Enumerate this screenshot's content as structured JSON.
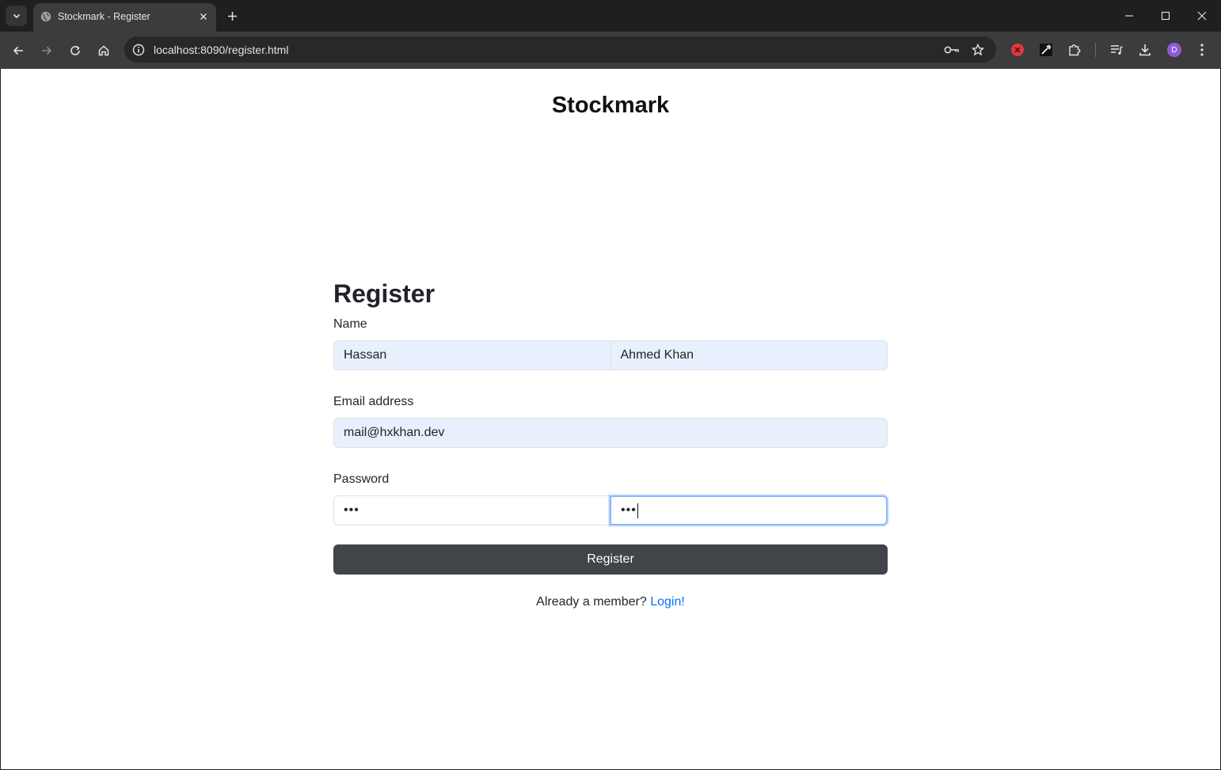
{
  "browser": {
    "tab_title": "Stockmark - Register",
    "url": "localhost:8090/register.html",
    "profile_initial": "D"
  },
  "page": {
    "brand": "Stockmark",
    "form_title": "Register",
    "name_label": "Name",
    "first_name_value": "Hassan",
    "last_name_value": "Ahmed Khan",
    "email_label": "Email address",
    "email_value": "mail@hxkhan.dev",
    "password_label": "Password",
    "password_value_masked": "•••",
    "confirm_password_value_masked": "•••",
    "register_button": "Register",
    "member_text": "Already a member?",
    "login_link": "Login!"
  },
  "icons": {
    "tab_search": "chevron-down-icon",
    "favicon": "globe-icon",
    "tab_close": "close-icon",
    "new_tab": "plus-icon",
    "back": "arrow-left-icon",
    "forward": "arrow-right-icon",
    "reload": "reload-icon",
    "home": "home-icon",
    "site_info": "info-icon",
    "password_key": "key-icon",
    "bookmark": "star-icon",
    "extension_error": "error-icon",
    "eyedropper": "eyedropper-icon",
    "extensions": "puzzle-icon",
    "media": "media-icon",
    "download": "download-icon",
    "menu": "kebab-menu-icon"
  },
  "colors": {
    "accent_link": "#0d6efd",
    "button_bg": "#414449",
    "autofill_bg": "#e8f0fe",
    "focus_border": "#86b7fe"
  }
}
